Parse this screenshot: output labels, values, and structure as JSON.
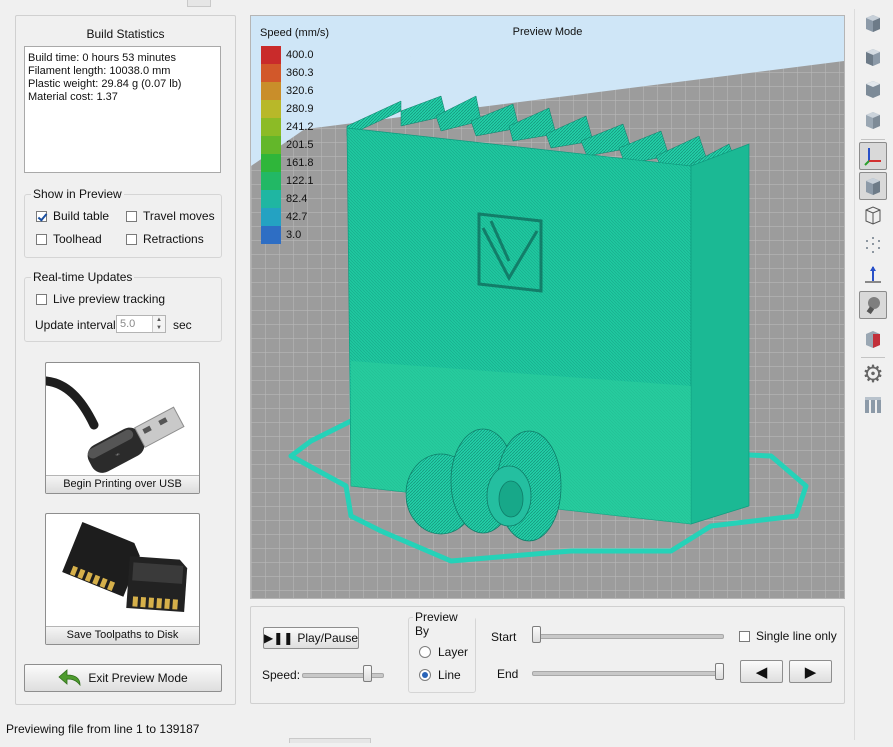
{
  "colors": {
    "accent": "#2a64b8",
    "print_color": "#1fc89f",
    "bed_color": "#9d9d9d",
    "sky_color": "#cfe6f7"
  },
  "build_statistics": {
    "title": "Build Statistics",
    "lines": [
      "Build time: 0 hours 53 minutes",
      "Filament length: 10038.0 mm",
      "Plastic weight: 29.84 g (0.07 lb)",
      "Material cost: 1.37"
    ]
  },
  "show_in_preview": {
    "title": "Show in Preview",
    "build_table": {
      "label": "Build table",
      "checked": true
    },
    "travel_moves": {
      "label": "Travel moves",
      "checked": false
    },
    "toolhead": {
      "label": "Toolhead",
      "checked": false
    },
    "retractions": {
      "label": "Retractions",
      "checked": false
    }
  },
  "realtime_updates": {
    "title": "Real-time Updates",
    "live_preview": {
      "label": "Live preview tracking",
      "checked": false
    },
    "interval_label": "Update interval",
    "interval_value": "5.0",
    "interval_unit": "sec"
  },
  "usb_button": {
    "label": "Begin Printing over USB",
    "icon": "usb-cable-icon"
  },
  "disk_button": {
    "label": "Save Toolpaths to Disk",
    "icon": "sd-card-icon"
  },
  "exit_button": {
    "label": "Exit Preview Mode",
    "icon": "back-arrow-icon"
  },
  "viewport": {
    "title": "Preview Mode",
    "legend_title": "Speed (mm/s)",
    "legend": [
      {
        "value": "400.0",
        "color": "#c92b2b"
      },
      {
        "value": "360.3",
        "color": "#d2582a"
      },
      {
        "value": "320.6",
        "color": "#c98e2a"
      },
      {
        "value": "280.9",
        "color": "#b8b829"
      },
      {
        "value": "241.2",
        "color": "#8cbb26"
      },
      {
        "value": "201.5",
        "color": "#63b72a"
      },
      {
        "value": "161.8",
        "color": "#2fb63a"
      },
      {
        "value": "122.1",
        "color": "#22b865"
      },
      {
        "value": "82.4",
        "color": "#1fb6a2"
      },
      {
        "value": "42.7",
        "color": "#24a2c2"
      },
      {
        "value": "3.0",
        "color": "#2e6ec4"
      }
    ]
  },
  "controls": {
    "play_pause": {
      "label": "Play/Pause",
      "icon": "play-pause-icon"
    },
    "speed_label": "Speed:",
    "speed_fraction": 0.86,
    "preview_by": {
      "title": "Preview By",
      "options": [
        {
          "label": "Layer",
          "selected": false
        },
        {
          "label": "Line",
          "selected": true
        }
      ]
    },
    "start_label": "Start",
    "end_label": "End",
    "start_fraction": 0.0,
    "end_fraction": 1.0,
    "single_line": {
      "label": "Single line only",
      "checked": false
    },
    "prev_icon": "left-triangle-icon",
    "next_icon": "right-triangle-icon"
  },
  "toolbar_icons": [
    "view-front-cube-icon",
    "view-side-cube-icon",
    "view-top-cube-icon",
    "view-iso-cube-icon",
    "axes-icon",
    "solid-cube-icon",
    "wireframe-cube-icon",
    "point-cloud-icon",
    "normals-icon",
    "light-bulb-icon",
    "section-cube-icon",
    "gear-icon",
    "bars-icon"
  ],
  "status": {
    "text": "Previewing file from line 1 to 139187"
  }
}
